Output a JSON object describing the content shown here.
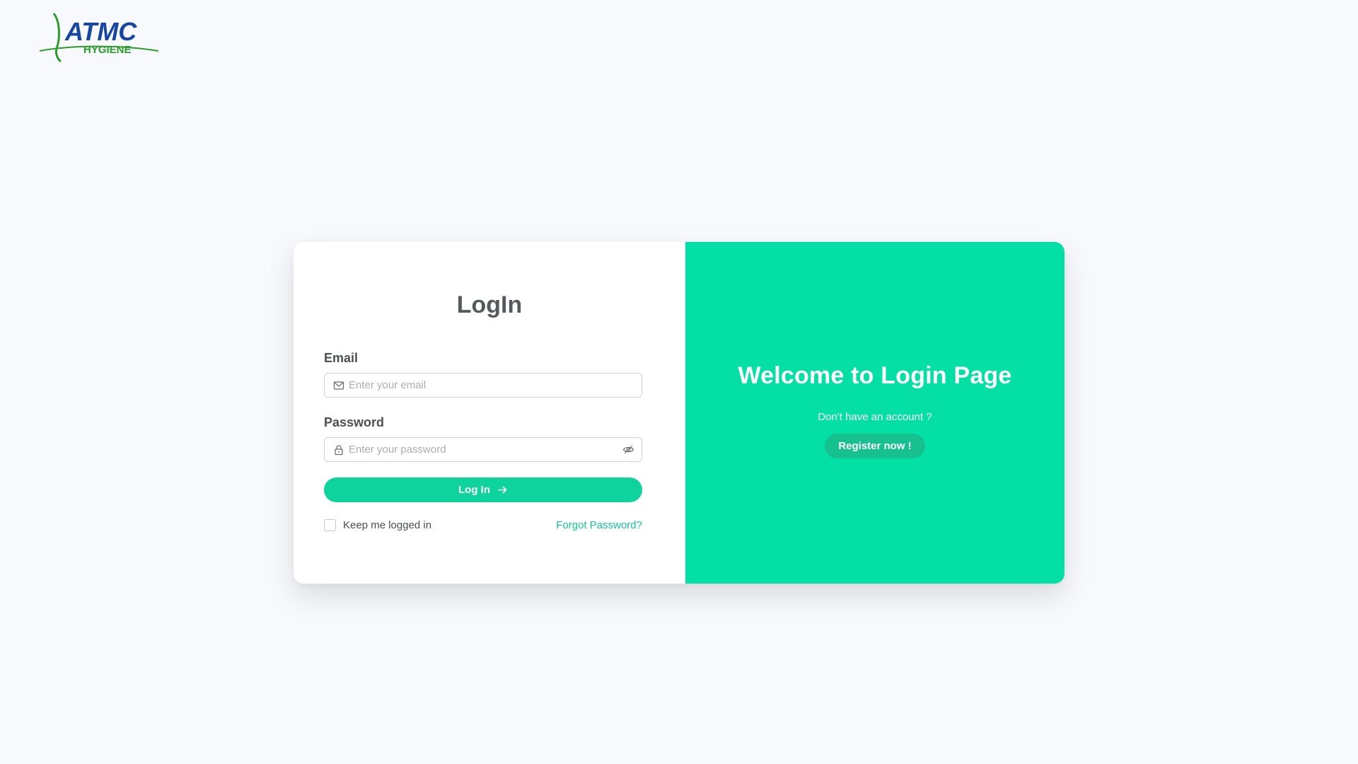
{
  "brand": {
    "logo_main": "ATMC",
    "logo_sub": "HYGIENE",
    "primary_color": "#03dfa5",
    "button_color": "#0fd39d",
    "logo_blue": "#1746a2",
    "logo_green": "#2a9d2a"
  },
  "login": {
    "title": "LogIn",
    "email_label": "Email",
    "email_placeholder": "Enter your email",
    "password_label": "Password",
    "password_placeholder": "Enter your password",
    "submit_label": "Log In",
    "remember_label": "Keep me logged in",
    "forgot_label": "Forgot Password?",
    "icons": {
      "email": "mail-icon",
      "password": "lock-icon",
      "toggle": "eye-off-icon",
      "submit": "arrow-right-icon"
    }
  },
  "welcome": {
    "title": "Welcome to Login Page",
    "prompt": "Don't have an account ?",
    "register_label": "Register now !"
  }
}
